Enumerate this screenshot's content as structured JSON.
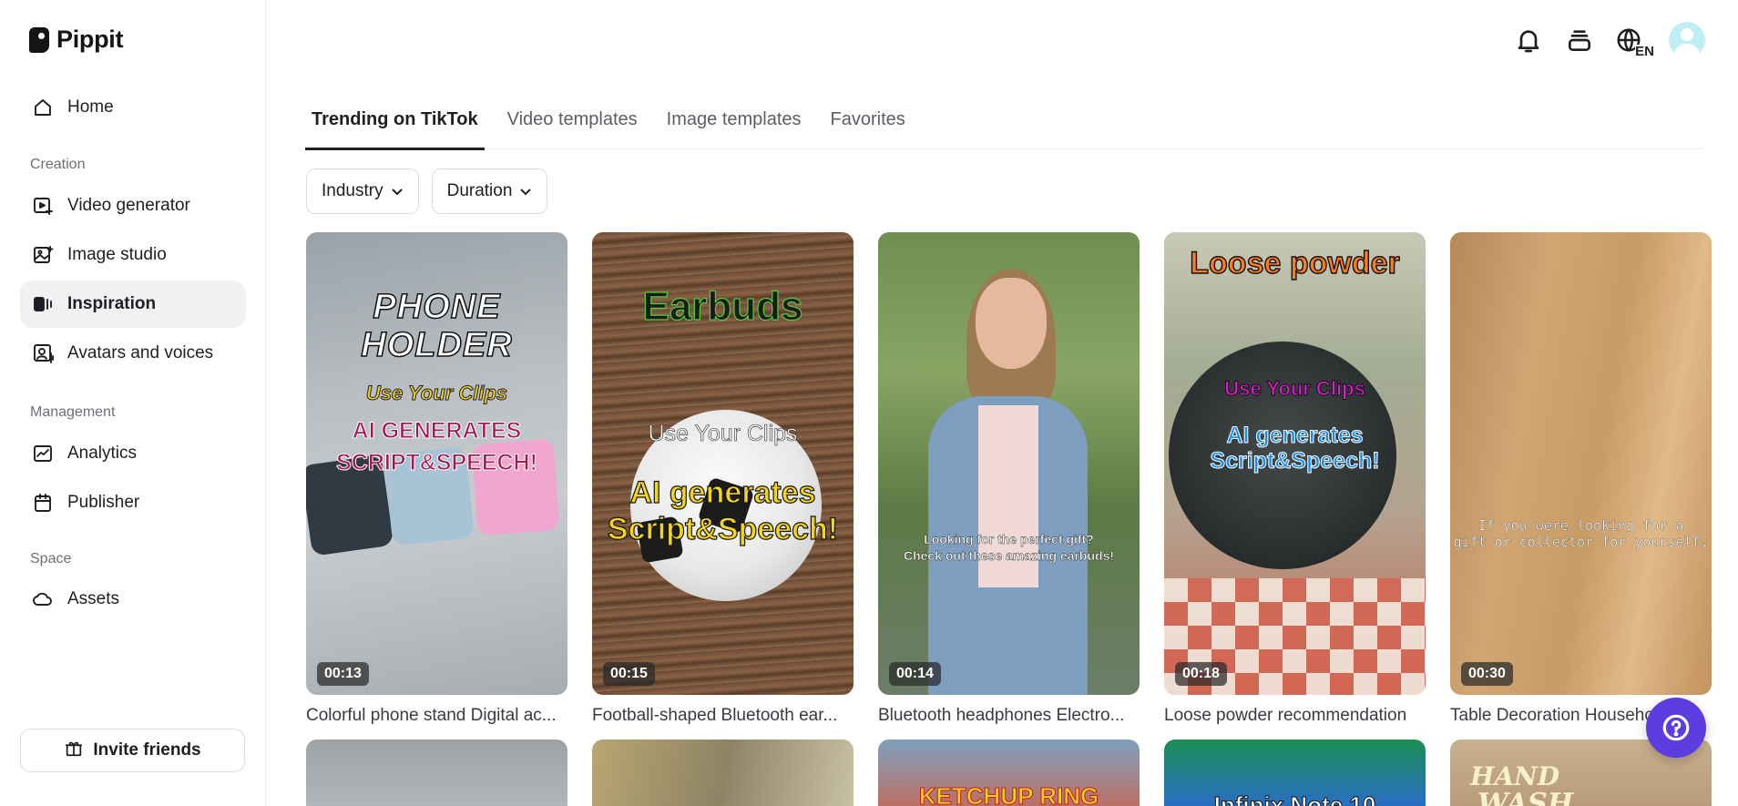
{
  "app": {
    "name": "Pippit"
  },
  "sidebar": {
    "home": {
      "label": "Home",
      "icon": "home-icon"
    },
    "sections": [
      {
        "label": "Creation",
        "items": [
          {
            "label": "Video generator",
            "icon": "video-generator-icon"
          },
          {
            "label": "Image studio",
            "icon": "image-studio-icon"
          },
          {
            "label": "Inspiration",
            "icon": "inspiration-icon",
            "active": true
          },
          {
            "label": "Avatars and voices",
            "icon": "avatar-voice-icon"
          }
        ]
      },
      {
        "label": "Management",
        "items": [
          {
            "label": "Analytics",
            "icon": "analytics-icon"
          },
          {
            "label": "Publisher",
            "icon": "calendar-icon"
          }
        ]
      },
      {
        "label": "Space",
        "items": [
          {
            "label": "Assets",
            "icon": "cloud-icon"
          }
        ]
      }
    ],
    "invite": {
      "label": "Invite friends",
      "icon": "gift-icon"
    }
  },
  "header": {
    "icons": [
      "bell-icon",
      "layers-icon",
      "language-icon",
      "avatar"
    ],
    "language_badge": "EN"
  },
  "tabs": [
    {
      "label": "Trending on TikTok",
      "active": true
    },
    {
      "label": "Video templates"
    },
    {
      "label": "Image templates"
    },
    {
      "label": "Favorites"
    }
  ],
  "filters": [
    {
      "label": "Industry"
    },
    {
      "label": "Duration"
    }
  ],
  "cards": [
    {
      "title": "Colorful phone stand Digital ac...",
      "duration": "00:13",
      "overlay": {
        "headline": "PHONE HOLDER",
        "line1": "Use Your Clips",
        "line2": "AI GENERATES",
        "line3": "SCRIPT&SPEECH!"
      }
    },
    {
      "title": "Football-shaped Bluetooth ear...",
      "duration": "00:15",
      "overlay": {
        "headline": "Earbuds",
        "line1": "Use Your Clips",
        "line2": "AI generates",
        "line3": "Script&Speech!"
      }
    },
    {
      "title": "Bluetooth headphones Electro...",
      "duration": "00:14",
      "overlay": {
        "line1": "Looking for the perfect gift?",
        "line2": "Check out these amazing earbuds!"
      }
    },
    {
      "title": "Loose powder recommendation",
      "duration": "00:18",
      "overlay": {
        "headline": "Loose powder",
        "line1": "Use Your Clips",
        "line2": "AI generates",
        "line3": "Script&Speech!"
      }
    },
    {
      "title": "Table Decoration Househo...",
      "duration": "00:30",
      "overlay": {
        "line1": "If you were looking for a",
        "line2": "gift or collector for yourself,"
      }
    }
  ],
  "row2_overlays": {
    "third": "KETCHUP RING",
    "fourth": "Infinix Note 10",
    "fifth_line1": "HAND",
    "fifth_line2": "WASH"
  },
  "help": {
    "icon": "help-icon"
  }
}
